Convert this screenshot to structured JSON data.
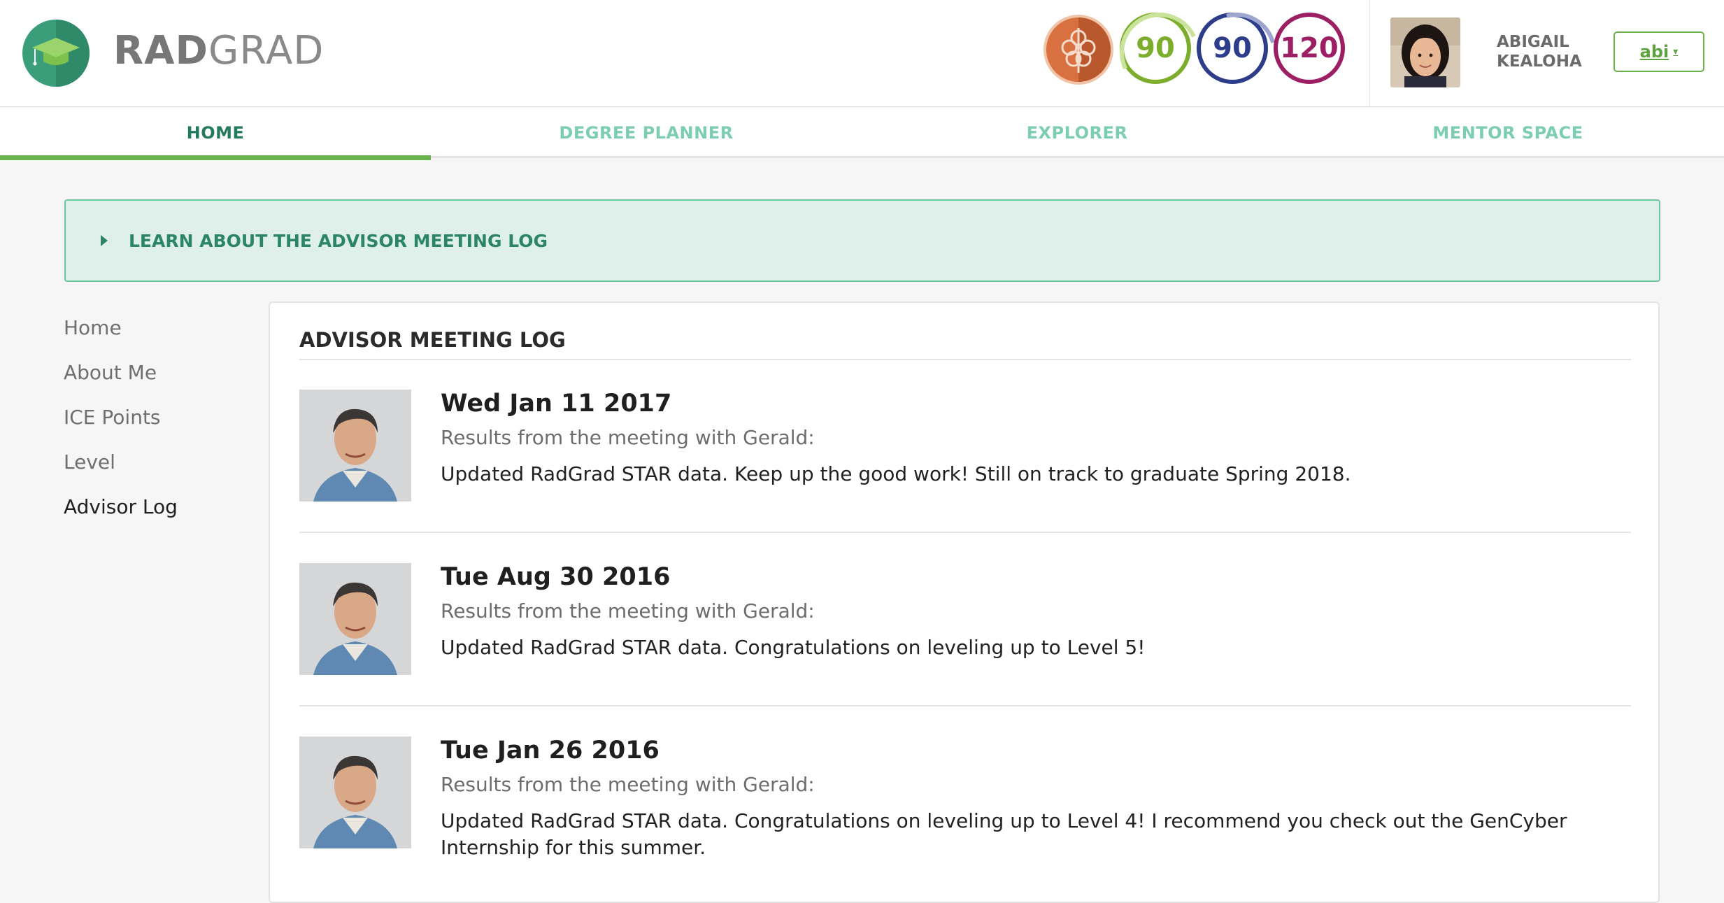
{
  "brand": {
    "part1": "RAD",
    "part2": "GRAD"
  },
  "scores": {
    "innovation": "90",
    "competency": "90",
    "experience": "120"
  },
  "user": {
    "first": "ABIGAIL",
    "last": "KEALOHA",
    "menu_label": "abi"
  },
  "nav": {
    "tabs": [
      {
        "label": "HOME"
      },
      {
        "label": "DEGREE PLANNER"
      },
      {
        "label": "EXPLORER"
      },
      {
        "label": "MENTOR SPACE"
      }
    ]
  },
  "learn": {
    "label": "LEARN ABOUT THE ADVISOR MEETING LOG"
  },
  "sidebar": {
    "items": [
      {
        "label": "Home"
      },
      {
        "label": "About Me"
      },
      {
        "label": "ICE Points"
      },
      {
        "label": "Level"
      },
      {
        "label": "Advisor Log"
      }
    ]
  },
  "log": {
    "title": "ADVISOR MEETING LOG",
    "entries": [
      {
        "date": "Wed Jan 11 2017",
        "intro": "Results from the meeting with Gerald:",
        "note": "Updated RadGrad STAR data. Keep up the good work! Still on track to graduate Spring 2018."
      },
      {
        "date": "Tue Aug 30 2016",
        "intro": "Results from the meeting with Gerald:",
        "note": "Updated RadGrad STAR data. Congratulations on leveling up to Level 5!"
      },
      {
        "date": "Tue Jan 26 2016",
        "intro": "Results from the meeting with Gerald:",
        "note": "Updated RadGrad STAR data. Congratulations on leveling up to Level 4! I recommend you check out the GenCyber Internship for this summer."
      }
    ]
  },
  "colors": {
    "accent_green": "#6ab24d",
    "nav_active": "#237a5c",
    "nav_inactive": "#7ccdb1",
    "innovation": "#7dad2c",
    "competency": "#2d3d8a",
    "experience": "#9c1f63"
  },
  "icons": {
    "logo": "graduation-cap-icon",
    "badge": "level-badge-icon",
    "caret": "caret-down-icon",
    "arrow": "triangle-right-icon"
  }
}
